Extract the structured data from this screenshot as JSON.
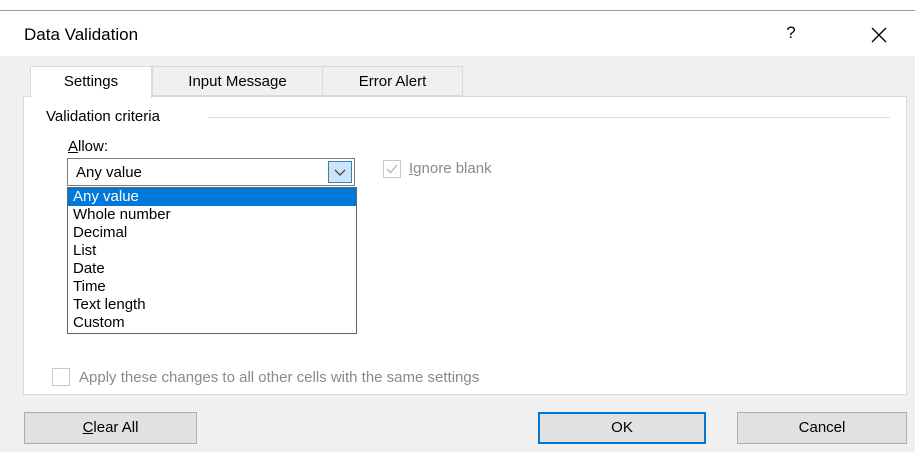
{
  "dialog": {
    "title": "Data Validation",
    "help_symbol": "?"
  },
  "tabs": [
    {
      "label": "Settings",
      "active": true
    },
    {
      "label": "Input Message",
      "active": false
    },
    {
      "label": "Error Alert",
      "active": false
    }
  ],
  "settings": {
    "group_label": "Validation criteria",
    "allow": {
      "label_mnemonic": "A",
      "label_rest": "llow:",
      "selected_value": "Any value",
      "options": [
        "Any value",
        "Whole number",
        "Decimal",
        "List",
        "Date",
        "Time",
        "Text length",
        "Custom"
      ],
      "selected_index": 0
    },
    "ignore_blank": {
      "mnemonic": "I",
      "rest": "gnore blank",
      "checked": true,
      "enabled": false
    },
    "apply_all": {
      "label": "Apply these changes to all other cells with the same settings",
      "checked": false,
      "enabled": false
    }
  },
  "buttons": {
    "clear_all_mnemonic": "C",
    "clear_all_rest": "lear All",
    "ok": "OK",
    "cancel": "Cancel"
  },
  "colors": {
    "selection": "#0078d7",
    "dialog_background": "#f0f0f0",
    "arrow_button": "#cce4f7"
  }
}
